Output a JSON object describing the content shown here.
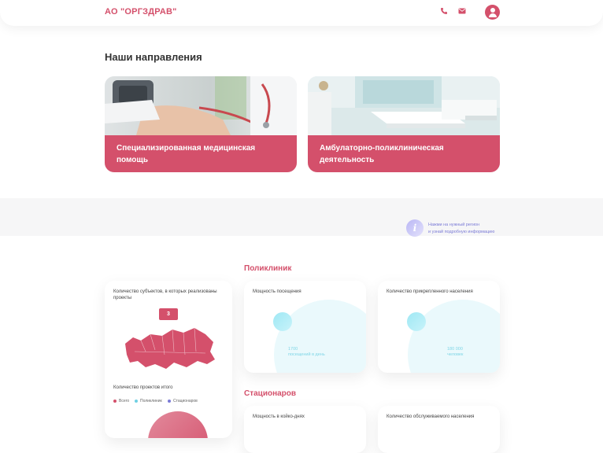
{
  "header": {
    "logo": "АО \"ОРГЗДРАВ\"",
    "icons": [
      "phone-icon",
      "mail-icon",
      "user-icon"
    ]
  },
  "directions": {
    "title": "Наши направления",
    "cards": [
      {
        "label": "Специализированная медицинская помощь"
      },
      {
        "label": "Амбулаторно-поликлиническая деятельность"
      }
    ]
  },
  "region_hint": {
    "line1": "Нажми на нужный регион",
    "line2": "и узнай подробную информацию"
  },
  "polyclinics": {
    "title": "Поликлиник",
    "regions_card": {
      "title": "Количество субъектов, в которых реализованы проекты",
      "count": "3"
    },
    "capacity_card": {
      "title": "Мощность посещения",
      "value": "1700",
      "unit": "посещений в день"
    },
    "population_card": {
      "title": "Количество прикрепленного населения",
      "value": "180 000",
      "unit": "человек"
    }
  },
  "totals": {
    "title": "Количество проектов итого",
    "legend": [
      {
        "label": "Всего",
        "color": "#d4506b"
      },
      {
        "label": "Поликлиник",
        "color": "#6fd0e3"
      },
      {
        "label": "Стационаров",
        "color": "#7a7ad6"
      }
    ]
  },
  "hospitals": {
    "title": "Стационаров",
    "beds_card": {
      "title": "Мощность в койко-днях"
    },
    "served_card": {
      "title": "Количество обслуживаемого населения"
    }
  },
  "colors": {
    "accent": "#d4506b",
    "teal": "#6fd0e3",
    "violet": "#7a7ad6"
  }
}
